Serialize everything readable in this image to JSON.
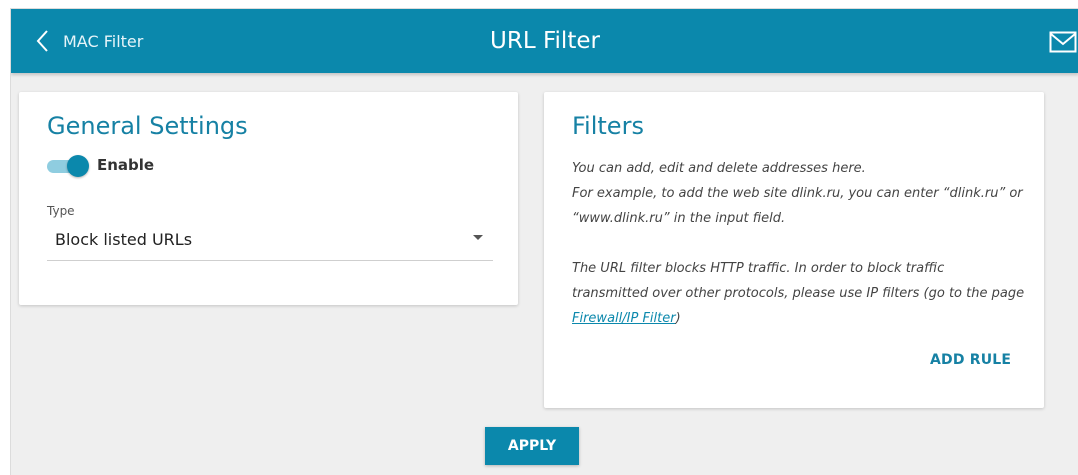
{
  "header": {
    "back_label": "MAC Filter",
    "title": "URL Filter"
  },
  "general": {
    "title": "General Settings",
    "enable_label": "Enable",
    "enable_on": true,
    "type_label": "Type",
    "type_value": "Block listed URLs"
  },
  "filters": {
    "title": "Filters",
    "line1": "You can add, edit and delete addresses here.",
    "line2": "For example, to add the web site dlink.ru, you can enter “dlink.ru” or",
    "line3": "“www.dlink.ru” in the input field.",
    "line4": "The URL filter blocks HTTP traffic. In order to block traffic",
    "line5": "transmitted over other protocols, please use IP filters (go to the page",
    "link_text": "Firewall/IP Filter",
    "link_suffix": ")",
    "add_rule_label": "ADD RULE"
  },
  "actions": {
    "apply_label": "APPLY"
  },
  "colors": {
    "accent": "#0b88ac",
    "background": "#efefef"
  }
}
